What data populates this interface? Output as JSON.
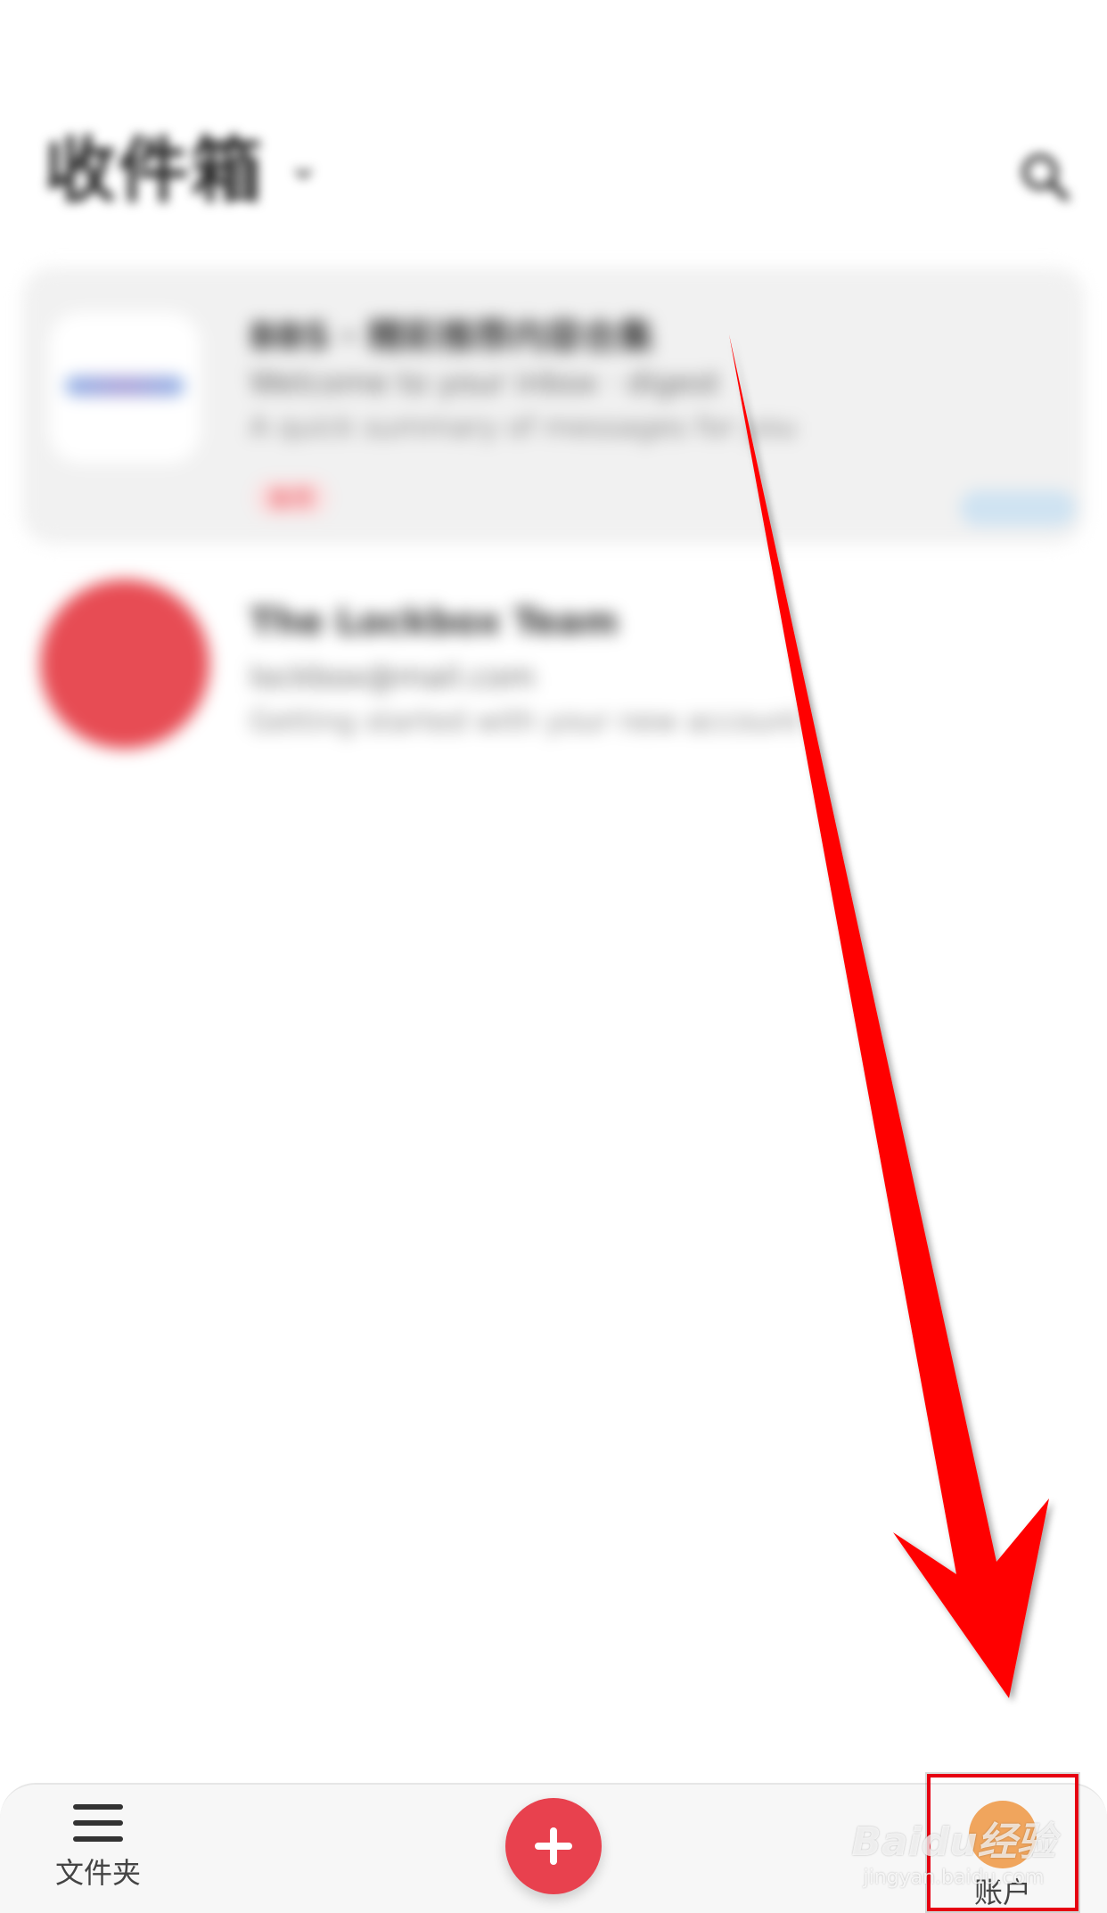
{
  "header": {
    "title": "收件箱",
    "chevron_glyph": "⌄",
    "search_icon": "search-icon"
  },
  "mail_list": {
    "items": [
      {
        "sender": "BBS · 精彩推荐内容合集",
        "subject": "Welcome to your inbox · digest",
        "preview": "A quick summary of messages for you",
        "time": "",
        "tag": "推荐",
        "thumbnail": "newsletter-thumbnail"
      },
      {
        "sender": "The Lockbox Team",
        "subject": "lockbox@mail.com",
        "preview": "Getting started with your new account",
        "time": "",
        "avatar_text": "",
        "avatar_color": "#e74c54"
      }
    ]
  },
  "bottom_nav": {
    "folders_label": "文件夹",
    "compose_icon": "plus-icon",
    "compose_color": "#e8414e",
    "account_label": "账户",
    "account_avatar_text": "",
    "account_avatar_color": "#f0a55d"
  },
  "watermark": {
    "logo": "Baidu经验",
    "url": "jingyan.baidu.com"
  },
  "annotation": {
    "arrow_color": "#ff0000",
    "box_color": "#e60012"
  }
}
